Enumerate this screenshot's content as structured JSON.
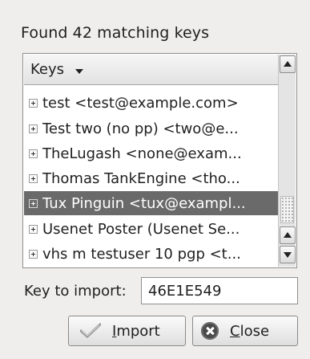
{
  "dialog": {
    "status_text": "Found 42 matching keys"
  },
  "key_list": {
    "column_header": "Keys",
    "rows": [
      {
        "label": "test <test@example.com>",
        "selected": false
      },
      {
        "label": "Test two (no pp) <two@e...",
        "selected": false
      },
      {
        "label": "TheLugash <none@exam...",
        "selected": false
      },
      {
        "label": "Thomas TankEngine <tho...",
        "selected": false
      },
      {
        "label": "Tux Pinguin <tux@exampl...",
        "selected": true
      },
      {
        "label": "Usenet Poster (Usenet Se...",
        "selected": false
      },
      {
        "label": "vhs m testuser 10  pgp <t...",
        "selected": false
      }
    ]
  },
  "import_field": {
    "label": "Key to import:",
    "value": "46E1E549"
  },
  "buttons": {
    "import_prefix": "",
    "import_mnemonic": "I",
    "import_rest": "mport",
    "close_prefix": "",
    "close_mnemonic": "C",
    "close_rest": "lose"
  },
  "icons": {
    "import": "checkmark-icon",
    "close": "close-circle-icon",
    "sort": "sort-down-arrow-icon",
    "scroll_up": "arrow-up-icon",
    "scroll_down": "arrow-down-icon",
    "expander": "plus-box-icon"
  },
  "colors": {
    "selection_bg": "#6a6a6a",
    "window_bg": "#efeeed"
  }
}
